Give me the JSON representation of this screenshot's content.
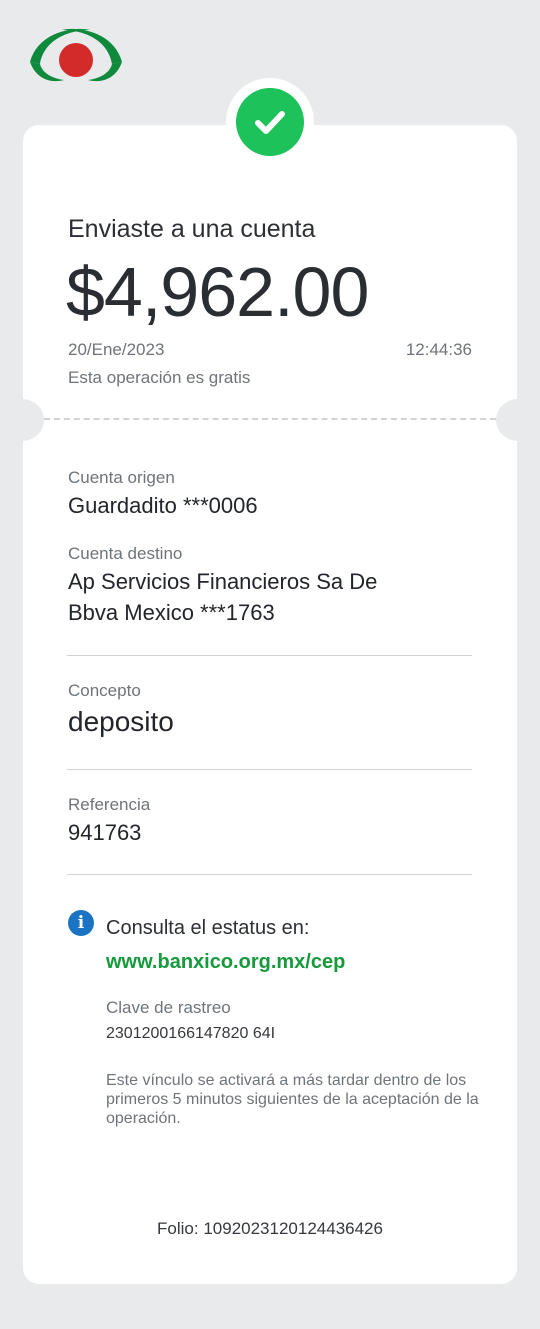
{
  "brand": {
    "logo_icon": "banxico-eagle-logo",
    "colors": {
      "green": "#0f8a3c",
      "red": "#d32a2a",
      "success": "#1dc25a",
      "info": "#1b73c4",
      "link": "#159a3c"
    }
  },
  "status": {
    "icon": "check-circle-icon"
  },
  "transfer": {
    "title": "Enviaste a una cuenta",
    "amount": "$4,962.00",
    "date": "20/Ene/2023",
    "time": "12:44:36",
    "fee_note": "Esta operación es gratis"
  },
  "details": {
    "origin_label": "Cuenta origen",
    "origin_value": "Guardadito ***0006",
    "dest_label": "Cuenta destino",
    "dest_line1": "Ap Servicios Financieros Sa De",
    "dest_line2": "Bbva Mexico ***1763",
    "concept_label": "Concepto",
    "concept_value": "deposito",
    "reference_label": "Referencia",
    "reference_value": "941763"
  },
  "info": {
    "icon": "info-icon",
    "text": "Consulta el estatus en:",
    "link": "www.banxico.org.mx/cep",
    "tracking_label": "Clave de rastreo",
    "tracking_value": "2301200166147820 64I",
    "note": "Este vínculo se activará a más tardar dentro de los primeros 5 minutos siguientes de la aceptación de la operación."
  },
  "folio": "Folio: 1092023120124436426"
}
